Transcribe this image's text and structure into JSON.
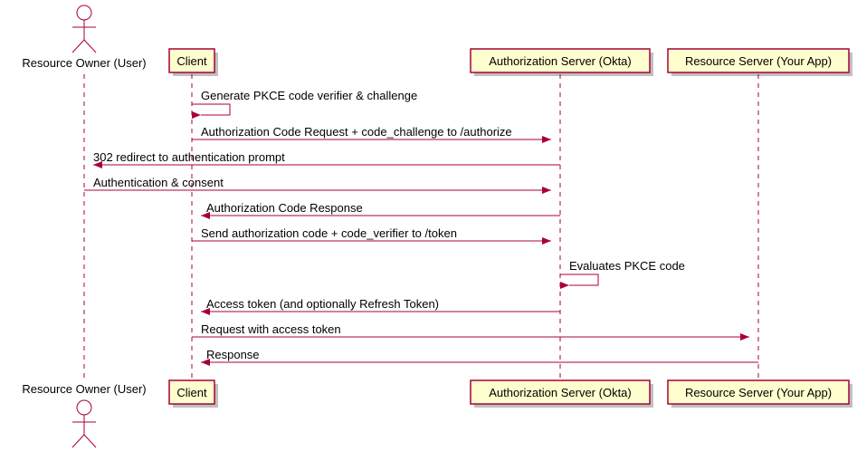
{
  "participants": [
    {
      "label": "Resource Owner (User)",
      "type": "actor"
    },
    {
      "label": "Client",
      "type": "box"
    },
    {
      "label": "Authorization Server (Okta)",
      "type": "box"
    },
    {
      "label": "Resource Server (Your App)",
      "type": "box"
    }
  ],
  "messages": [
    {
      "label": "Generate PKCE code verifier & challenge",
      "from": 1,
      "to": 1
    },
    {
      "label": "Authorization Code Request + code_challenge to /authorize",
      "from": 1,
      "to": 2
    },
    {
      "label": "302 redirect to authentication prompt",
      "from": 2,
      "to": 0
    },
    {
      "label": "Authentication & consent",
      "from": 0,
      "to": 2
    },
    {
      "label": "Authorization Code Response",
      "from": 2,
      "to": 1
    },
    {
      "label": "Send authorization code + code_verifier to /token",
      "from": 1,
      "to": 2
    },
    {
      "label": "Evaluates PKCE code",
      "from": 2,
      "to": 2
    },
    {
      "label": "Access token (and optionally Refresh Token)",
      "from": 2,
      "to": 1
    },
    {
      "label": "Request with access token",
      "from": 1,
      "to": 3
    },
    {
      "label": "Response",
      "from": 3,
      "to": 1
    }
  ]
}
